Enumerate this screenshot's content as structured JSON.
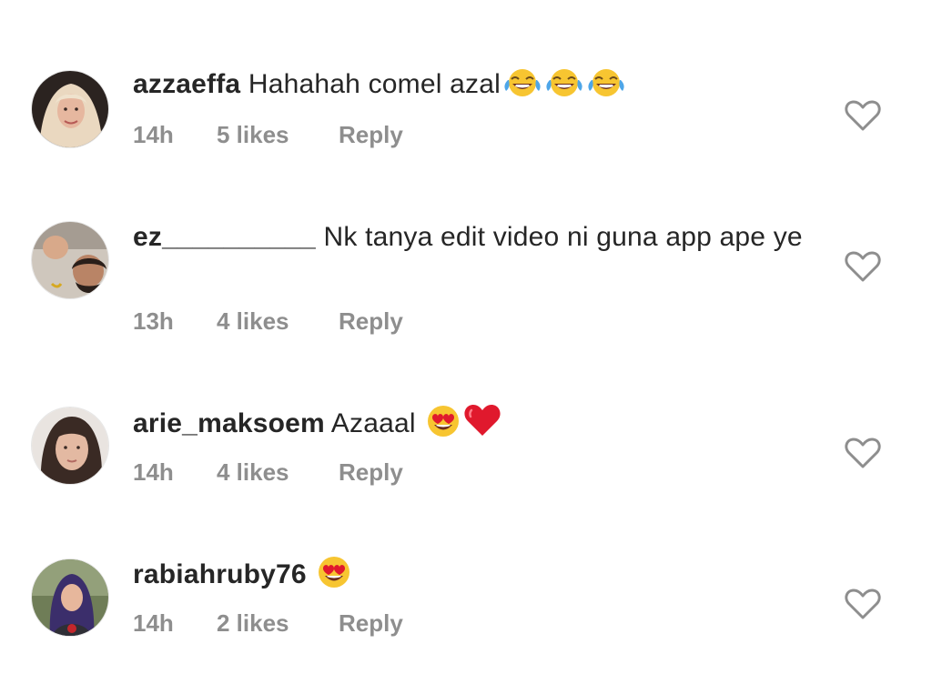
{
  "comments": [
    {
      "username": "azzaeffa",
      "text": "Hahahah comel azal",
      "emoji": [
        "face-with-tears-of-joy",
        "face-with-tears-of-joy",
        "face-with-tears-of-joy"
      ],
      "time": "14h",
      "likes": "5 likes",
      "reply": "Reply"
    },
    {
      "username": "ez__________",
      "text": "Nk tanya edit video ni guna app ape ye",
      "emoji": [],
      "time": "13h",
      "likes": "4 likes",
      "reply": "Reply"
    },
    {
      "username": "arie_maksoem",
      "text": "Azaaal",
      "emoji": [
        "smiling-face-with-heart-eyes",
        "red-heart"
      ],
      "time": "14h",
      "likes": "4 likes",
      "reply": "Reply"
    },
    {
      "username": "rabiahruby76",
      "text": "",
      "emoji": [
        "smiling-face-with-heart-eyes"
      ],
      "time": "14h",
      "likes": "2 likes",
      "reply": "Reply"
    }
  ],
  "icons": {
    "like": "heart-outline-icon"
  },
  "colors": {
    "text": "#262626",
    "meta": "#8e8e8e",
    "heart_red": "#e0192d"
  }
}
